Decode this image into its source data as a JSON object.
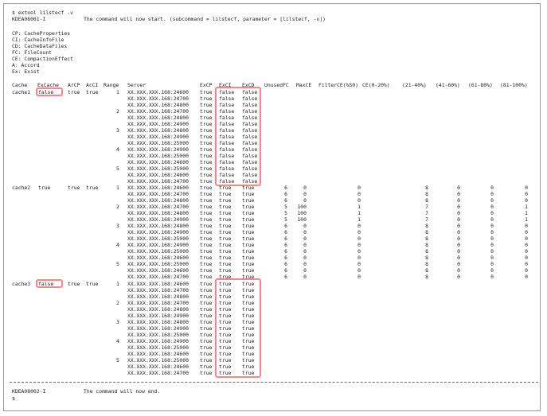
{
  "intro": {
    "cmd": "$ extool lilstecf -v",
    "msg_code": "KDEA08001-I",
    "msg_text": "The command will now start. (subcommand = lilstecf, parameter = [lilstecf, -v])"
  },
  "legend": [
    "CP: CacheProperties",
    "CI: CacheInfoFile",
    "CD: CacheDataFiles",
    "FC: FileCount",
    "CE: CompactionEffect",
    "A: Accord",
    "Ex: Exist"
  ],
  "headers": [
    "Cache",
    "ExCache",
    "ArCP",
    "AcCI",
    "Range",
    "Server",
    "ExCP",
    "ExCI",
    "ExCD",
    "UnusedFC",
    "MaxCE",
    "FilterCE(%50)",
    "CE(0-20%)",
    "(21-40%)",
    "(41-60%)",
    "(61-80%)",
    "(81-100%)"
  ],
  "servers": [
    "XX.XXX.XXX.168:24600",
    "XX.XXX.XXX.168:24700",
    "XX.XXX.XXX.168:24800",
    "XX.XXX.XXX.168:24700",
    "XX.XXX.XXX.168:24800",
    "XX.XXX.XXX.168:24900",
    "XX.XXX.XXX.168:24800",
    "XX.XXX.XXX.168:24900",
    "XX.XXX.XXX.168:25000",
    "XX.XXX.XXX.168:24900",
    "XX.XXX.XXX.168:25000",
    "XX.XXX.XXX.168:24600",
    "XX.XXX.XXX.168:25000",
    "XX.XXX.XXX.168:24600",
    "XX.XXX.XXX.168:24700"
  ],
  "caches": [
    {
      "name": "cache1",
      "excache": "false",
      "arcp": "true",
      "acci": "true",
      "excp": "true",
      "exci": "false",
      "excd": "false",
      "stats": []
    },
    {
      "name": "cache2",
      "excache": "true",
      "arcp": "true",
      "acci": "true",
      "excp": "true",
      "exci": "true",
      "excd": "true",
      "stats": [
        [
          "6",
          "0",
          "0",
          "8",
          "0",
          "0",
          "0"
        ],
        [
          "6",
          "0",
          "0",
          "8",
          "0",
          "0",
          "0"
        ],
        [
          "6",
          "0",
          "0",
          "8",
          "0",
          "0",
          "0"
        ],
        [
          "5",
          "100",
          "1",
          "7",
          "0",
          "0",
          "1"
        ],
        [
          "5",
          "100",
          "1",
          "7",
          "0",
          "0",
          "1"
        ],
        [
          "5",
          "100",
          "1",
          "7",
          "0",
          "0",
          "1"
        ],
        [
          "6",
          "0",
          "0",
          "8",
          "0",
          "0",
          "0"
        ],
        [
          "6",
          "0",
          "0",
          "8",
          "0",
          "0",
          "0"
        ],
        [
          "6",
          "0",
          "0",
          "8",
          "0",
          "0",
          "0"
        ],
        [
          "6",
          "0",
          "0",
          "8",
          "0",
          "0",
          "0"
        ],
        [
          "6",
          "0",
          "0",
          "8",
          "0",
          "0",
          "0"
        ],
        [
          "6",
          "0",
          "0",
          "8",
          "0",
          "0",
          "0"
        ],
        [
          "6",
          "0",
          "0",
          "8",
          "0",
          "0",
          "0"
        ],
        [
          "6",
          "0",
          "0",
          "8",
          "0",
          "0",
          "0"
        ],
        [
          "6",
          "0",
          "0",
          "8",
          "0",
          "0",
          "0"
        ]
      ]
    },
    {
      "name": "cache3",
      "excache": "false",
      "arcp": "true",
      "acci": "true",
      "excp": "true",
      "exci": "true",
      "excd": "true",
      "stats": []
    }
  ],
  "outro": {
    "msg_code": "KDEA08002-I",
    "msg_text": "The command will now end.",
    "prompt": "$"
  }
}
